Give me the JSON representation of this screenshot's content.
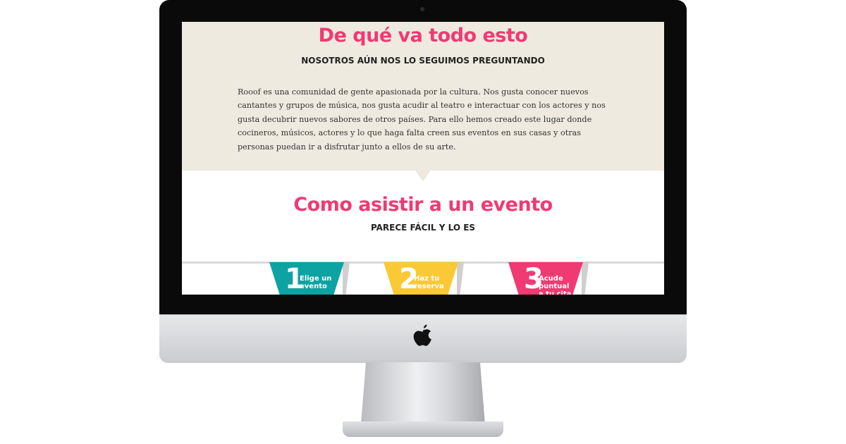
{
  "about": {
    "title": "De qué va todo esto",
    "subtitle": "NOSOTROS AÚN NOS LO SEGUIMOS PREGUNTANDO",
    "text": "Rooof es una comunidad de gente apasionada por la cultura. Nos gusta conocer nuevos cantantes y grupos de música, nos gusta acudir al teatro e interactuar con los actores y nos gusta decubrir nuevos sabores de otros países. Para ello hemos creado este lugar donde cocineros, músicos, actores y lo que haga falta creen sus eventos en sus casas y otras personas puedan ir a disfrutar junto a ellos de su arte."
  },
  "how": {
    "title": "Como asistir a un evento",
    "subtitle": "PARECE FÁCIL Y LO ES"
  },
  "steps": [
    {
      "number": "1",
      "label": "Elige un evento",
      "color": "#0ea3a3"
    },
    {
      "number": "2",
      "label": "Haz tu reserva",
      "color": "#fbc936"
    },
    {
      "number": "3",
      "label": "Acude puntual a tu cita",
      "color": "#f03a73"
    }
  ],
  "colors": {
    "accent": "#f03a73",
    "about_bg": "#eeeae0",
    "monitor_bezel": "#0a0a0a"
  },
  "icons": {
    "monitor_logo": "apple-icon"
  }
}
